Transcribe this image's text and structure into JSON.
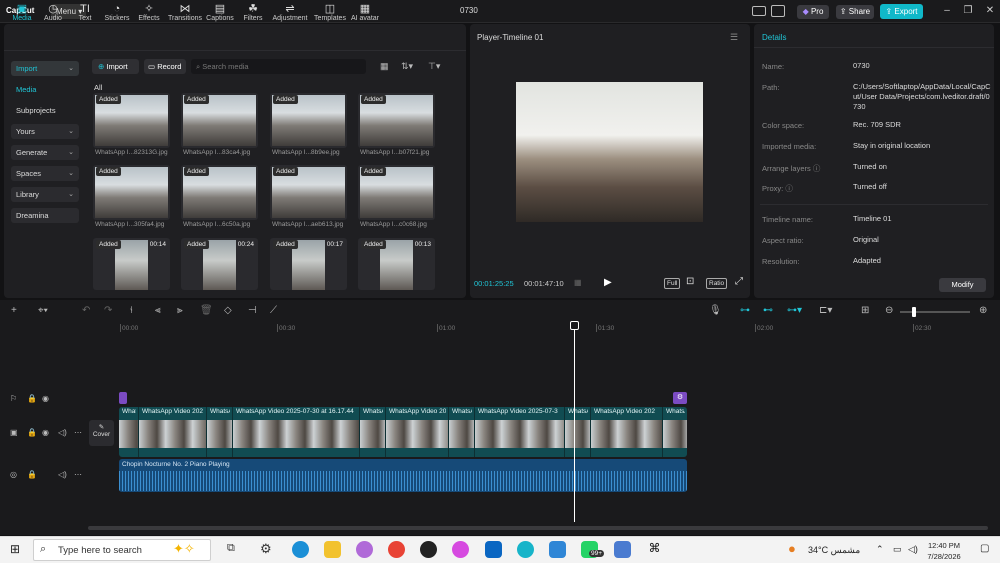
{
  "app": {
    "name": "CapCut",
    "menu_label": "Menu",
    "project_title": "0730",
    "pro_label": "Pro",
    "share_label": "Share",
    "export_label": "Export"
  },
  "toolbar": {
    "tabs": [
      {
        "label": "Media",
        "icon": "media-icon"
      },
      {
        "label": "Audio",
        "icon": "audio-icon"
      },
      {
        "label": "Text",
        "icon": "text-icon"
      },
      {
        "label": "Stickers",
        "icon": "stickers-icon"
      },
      {
        "label": "Effects",
        "icon": "effects-icon"
      },
      {
        "label": "Transitions",
        "icon": "transitions-icon"
      },
      {
        "label": "Captions",
        "icon": "captions-icon"
      },
      {
        "label": "Filters",
        "icon": "filters-icon"
      },
      {
        "label": "Adjustment",
        "icon": "adjustment-icon"
      },
      {
        "label": "Templates",
        "icon": "templates-icon"
      },
      {
        "label": "AI avatar",
        "icon": "ai-avatar-icon"
      }
    ],
    "accent": "#20c5d6"
  },
  "sidebar": {
    "import": "Import",
    "media": "Media",
    "subprojects": "Subprojects",
    "yours": "Yours",
    "generate": "Generate",
    "spaces": "Spaces",
    "library": "Library",
    "dreamina": "Dreamina"
  },
  "media": {
    "import_label": "Import",
    "record_label": "Record",
    "search_placeholder": "Search media",
    "all_label": "All",
    "items": [
      {
        "tag": "Added",
        "caption": "WhatsApp I...82313G.jpg",
        "dur": ""
      },
      {
        "tag": "Added",
        "caption": "WhatsApp I...83ca4.jpg",
        "dur": ""
      },
      {
        "tag": "Added",
        "caption": "WhatsApp I...8b9ee.jpg",
        "dur": ""
      },
      {
        "tag": "Added",
        "caption": "WhatsApp I...b07f21.jpg",
        "dur": ""
      },
      {
        "tag": "Added",
        "caption": "WhatsApp I...305fa4.jpg",
        "dur": ""
      },
      {
        "tag": "Added",
        "caption": "WhatsApp I...6c50a.jpg",
        "dur": ""
      },
      {
        "tag": "Added",
        "caption": "WhatsApp I...aeb613.jpg",
        "dur": ""
      },
      {
        "tag": "Added",
        "caption": "WhatsApp I...c0c68.jpg",
        "dur": ""
      },
      {
        "tag": "Added",
        "caption": "",
        "dur": "00:14"
      },
      {
        "tag": "Added",
        "caption": "",
        "dur": "00:24"
      },
      {
        "tag": "Added",
        "caption": "",
        "dur": "00:17"
      },
      {
        "tag": "Added",
        "caption": "",
        "dur": "00:13"
      }
    ]
  },
  "player": {
    "title": "Player-Timeline 01",
    "current_time": "00:01:25:25",
    "total_time": "00:01:47:10",
    "full_label": "Full",
    "ratio_label": "Ratio"
  },
  "details": {
    "title": "Details",
    "rows": [
      {
        "label": "Name:",
        "value": "0730"
      },
      {
        "label": "Path:",
        "value": "C:/Users/Softlaptop/AppData/Local/CapCut/User Data/Projects/com.lveditor.draft/0730"
      },
      {
        "label": "Color space:",
        "value": "Rec. 709 SDR"
      },
      {
        "label": "Imported media:",
        "value": "Stay in original location"
      },
      {
        "label": "Arrange layers",
        "value": "Turned on"
      },
      {
        "label": "Proxy:",
        "value": "Turned off"
      },
      {
        "label": "Timeline name:",
        "value": "Timeline 01"
      },
      {
        "label": "Aspect ratio:",
        "value": "Original"
      },
      {
        "label": "Resolution:",
        "value": "Adapted"
      }
    ],
    "modify_label": "Modify"
  },
  "timeline": {
    "ticks": [
      "00:00",
      "00:30",
      "01:00",
      "01:30",
      "02:00",
      "02:30"
    ],
    "cover_label": "Cover",
    "clips": [
      "WhatsApp Video 202",
      "WhatsA",
      "WhatsApp Video 2025-07-30 at 16.17.44",
      "WhatsA",
      "WhatsApp Video 20",
      "WhatsA",
      "WhatsApp Video 2025-07-3",
      "WhatsA",
      "WhatsApp Video 202",
      "WhatsA"
    ],
    "audio_label": "Chopin Nocturne No. 2 Piano Playing"
  },
  "taskbar": {
    "search_placeholder": "Type here to search",
    "weather": "34°C",
    "weather_loc": "مشمس",
    "time": "12:40 PM",
    "date": "7/28/2026",
    "badge": "99+"
  }
}
